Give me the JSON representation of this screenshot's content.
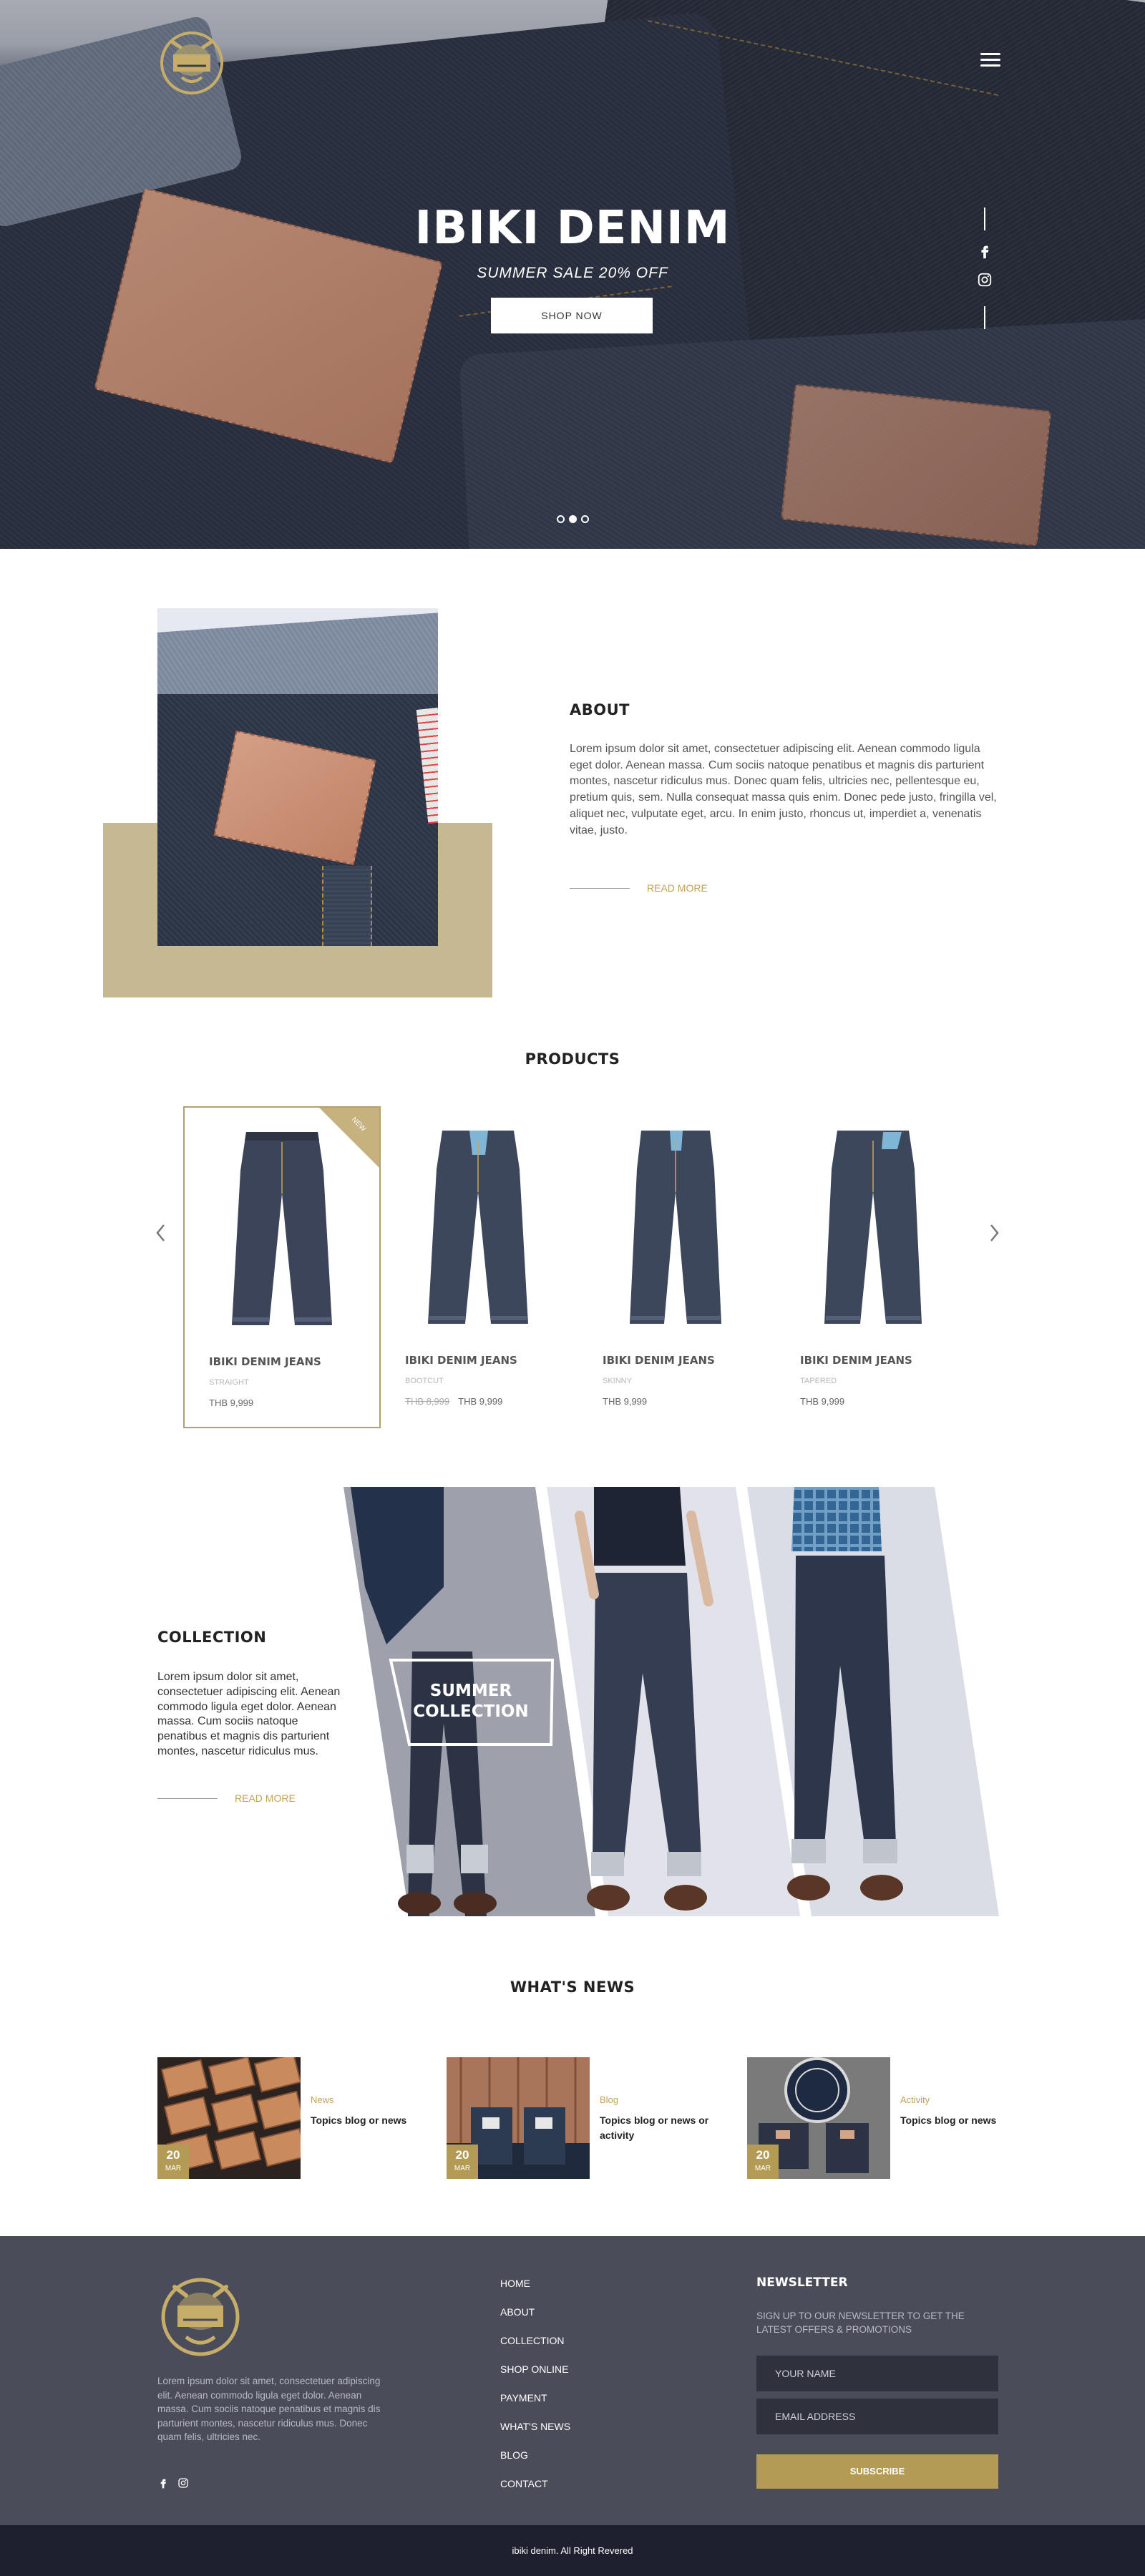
{
  "hero": {
    "title": "IBIKI DENIM",
    "subtitle": "SUMMER SALE 20% OFF",
    "cta": "SHOP NOW",
    "slides_total": 3,
    "slide_active": 2
  },
  "header": {
    "menu_icon": "hamburger-menu-icon"
  },
  "social": {
    "icons": [
      "facebook-icon",
      "instagram-icon"
    ]
  },
  "about": {
    "title": "ABOUT",
    "text": "Lorem ipsum dolor sit amet, consectetuer adipiscing elit. Aenean commodo ligula eget dolor. Aenean massa. Cum sociis natoque penatibus et magnis dis parturient montes, nascetur ridiculus mus. Donec quam felis, ultricies nec, pellentesque eu, pretium quis, sem. Nulla consequat massa quis enim. Donec pede justo, fringilla vel, aliquet nec, vulputate eget, arcu. In enim justo, rhoncus ut, imperdiet a, venenatis vitae, justo.",
    "read_more": "READ MORE"
  },
  "products": {
    "title": "PRODUCTS",
    "items": [
      {
        "name": "IBIKI DENIM JEANS",
        "category": "STRAIGHT",
        "price": "THB 9,999",
        "old_price": "",
        "badge": "NEW"
      },
      {
        "name": "IBIKI DENIM JEANS",
        "category": "BOOTCUT",
        "price": "THB 9,999",
        "old_price": "THB 8,999",
        "badge": ""
      },
      {
        "name": "IBIKI DENIM JEANS",
        "category": "SKINNY",
        "price": "THB 9,999",
        "old_price": "",
        "badge": ""
      },
      {
        "name": "IBIKI DENIM JEANS",
        "category": "TAPERED",
        "price": "THB 9,999",
        "old_price": "",
        "badge": ""
      }
    ]
  },
  "collection": {
    "title": "COLLECTION",
    "text": "Lorem ipsum dolor sit amet, consectetuer adipiscing elit. Aenean commodo ligula eget dolor. Aenean massa. Cum sociis natoque penatibus et magnis dis parturient montes, nascetur ridiculus mus.",
    "read_more": "READ MORE",
    "overlay_line1": "SUMMER",
    "overlay_line2": "COLLECTION"
  },
  "news": {
    "title": "WHAT'S NEWS",
    "items": [
      {
        "category": "News",
        "headline": "Topics blog or news",
        "day": "20",
        "month": "MAR"
      },
      {
        "category": "Blog",
        "headline": "Topics blog or news or activity",
        "day": "20",
        "month": "MAR"
      },
      {
        "category": "Activity",
        "headline": "Topics blog or news",
        "day": "20",
        "month": "MAR"
      }
    ]
  },
  "footer": {
    "about_text": "Lorem ipsum dolor sit amet, consectetuer adipiscing elit. Aenean commodo ligula eget dolor. Aenean massa. Cum sociis natoque penatibus et magnis dis parturient montes, nascetur ridiculus mus. Donec quam felis, ultricies nec.",
    "menu": [
      "HOME",
      "ABOUT",
      "COLLECTION",
      "SHOP ONLINE",
      "PAYMENT",
      "WHAT'S NEWS",
      "BLOG",
      "CONTACT"
    ],
    "newsletter_title": "NEWSLETTER",
    "newsletter_sub": "SIGN UP TO OUR NEWSLETTER TO GET THE LATEST OFFERS & PROMOTIONS",
    "name_placeholder": "YOUR NAME",
    "email_placeholder": "EMAIL ADDRESS",
    "subscribe": "SUBSCRIBE",
    "copyright": "ibiki denim. All Right Revered"
  },
  "colors": {
    "accent_gold": "#b39b55",
    "about_block": "#c6b892",
    "footer_bg": "#4a4c5a",
    "bottom_bar": "#1e2030"
  }
}
